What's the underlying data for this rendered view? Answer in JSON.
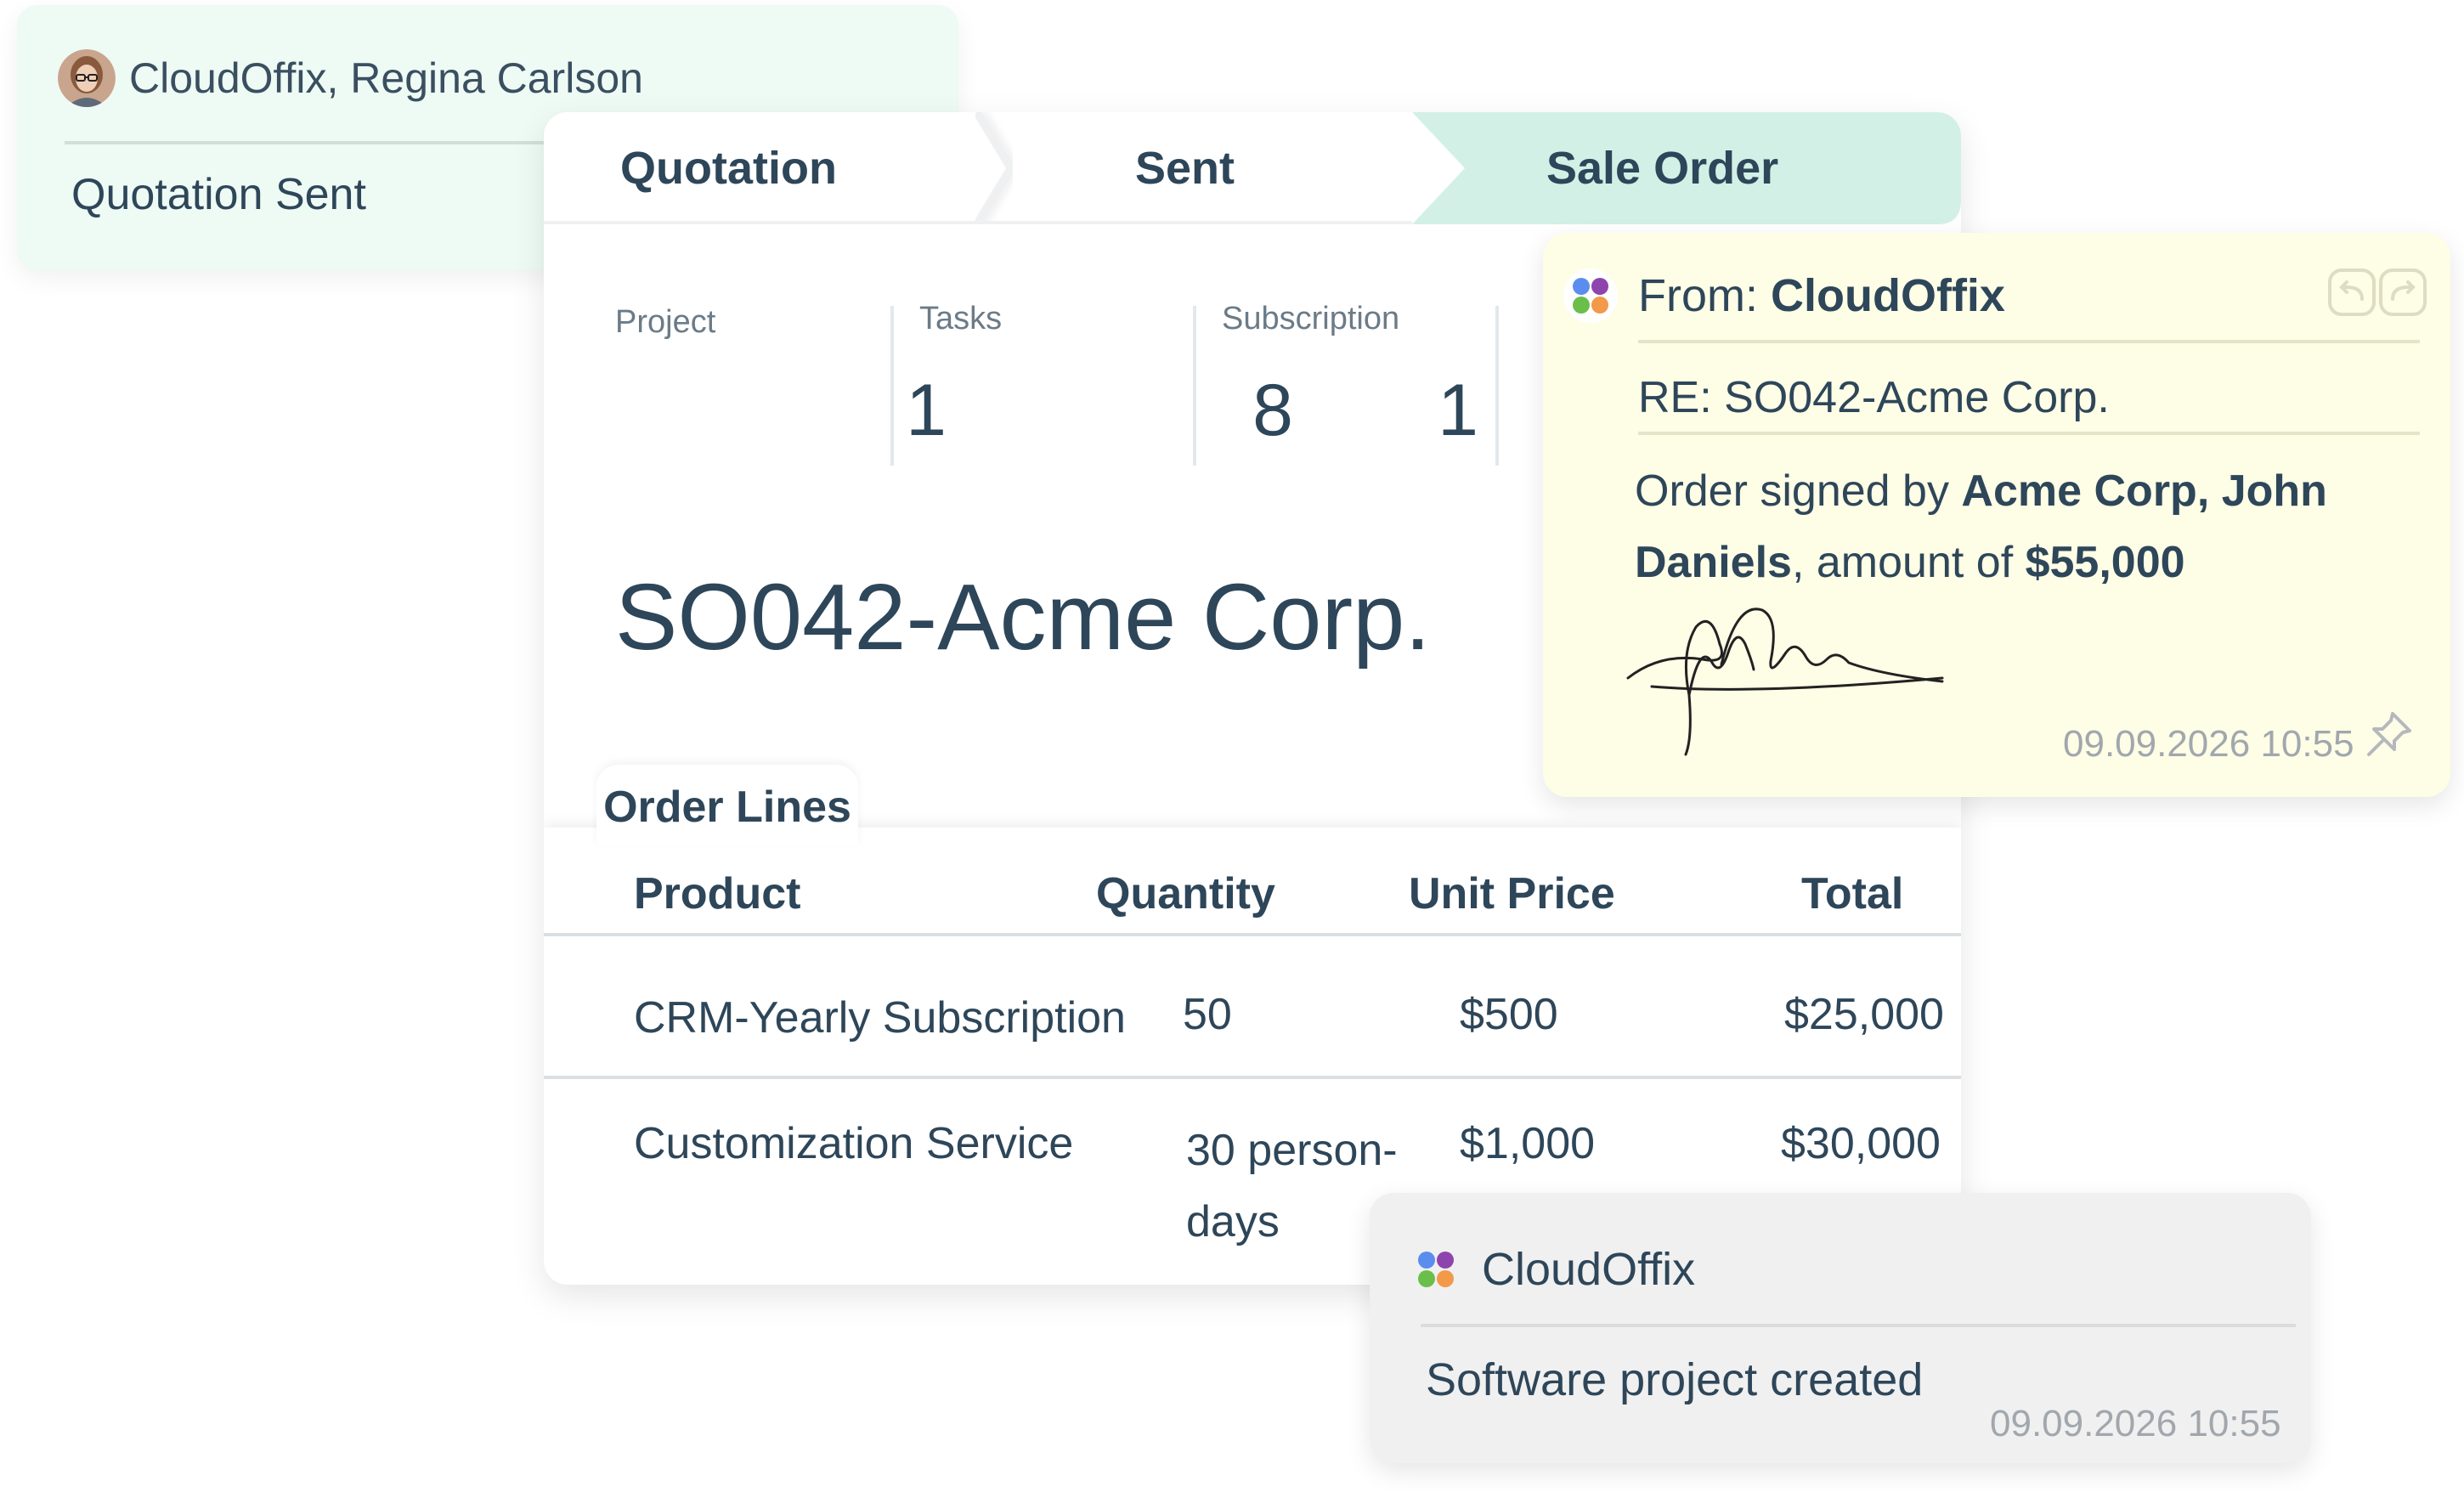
{
  "activity": {
    "author": "CloudOffix, Regina Carlson",
    "event": "Quotation Sent"
  },
  "stages": [
    "Quotation",
    "Sent",
    "Sale Order"
  ],
  "active_stage": "Sale Order",
  "smart_buttons": [
    {
      "label": "Project",
      "value": "1"
    },
    {
      "label": "Tasks",
      "value": "8"
    },
    {
      "label": "Subscription",
      "value": "1"
    }
  ],
  "record_title": "SO042-Acme Corp.",
  "order_lines": {
    "tab_label": "Order Lines",
    "columns": [
      "Product",
      "Quantity",
      "Unit Price",
      "Total"
    ],
    "rows": [
      {
        "product": "CRM-Yearly Subscription",
        "quantity": "50",
        "unit_price": "$500",
        "total": "$25,000"
      },
      {
        "product": "Customization Service",
        "quantity_line1": "30 person-",
        "quantity_line2": "days",
        "unit_price": "$1,000",
        "total": "$30,000"
      }
    ]
  },
  "email": {
    "from_label": "From: ",
    "from_name": "CloudOffix",
    "subject": "RE: SO042-Acme Corp.",
    "body_prefix": "Order signed by ",
    "signer": "Acme Corp, John Daniels",
    "body_middle": ", amount of ",
    "amount": "$55,000",
    "timestamp": "09.09.2026 10:55"
  },
  "system_note": {
    "author": "CloudOffix",
    "message": "Software project created",
    "timestamp": "09.09.2026 10:55"
  },
  "colors": {
    "text": "#2e4659",
    "active_stage_bg": "#d3f0e6",
    "activity_bg": "#eefaf4",
    "email_bg": "#fefde6",
    "system_bg": "#f0f0f0",
    "timestamp": "#a1a7ad"
  }
}
